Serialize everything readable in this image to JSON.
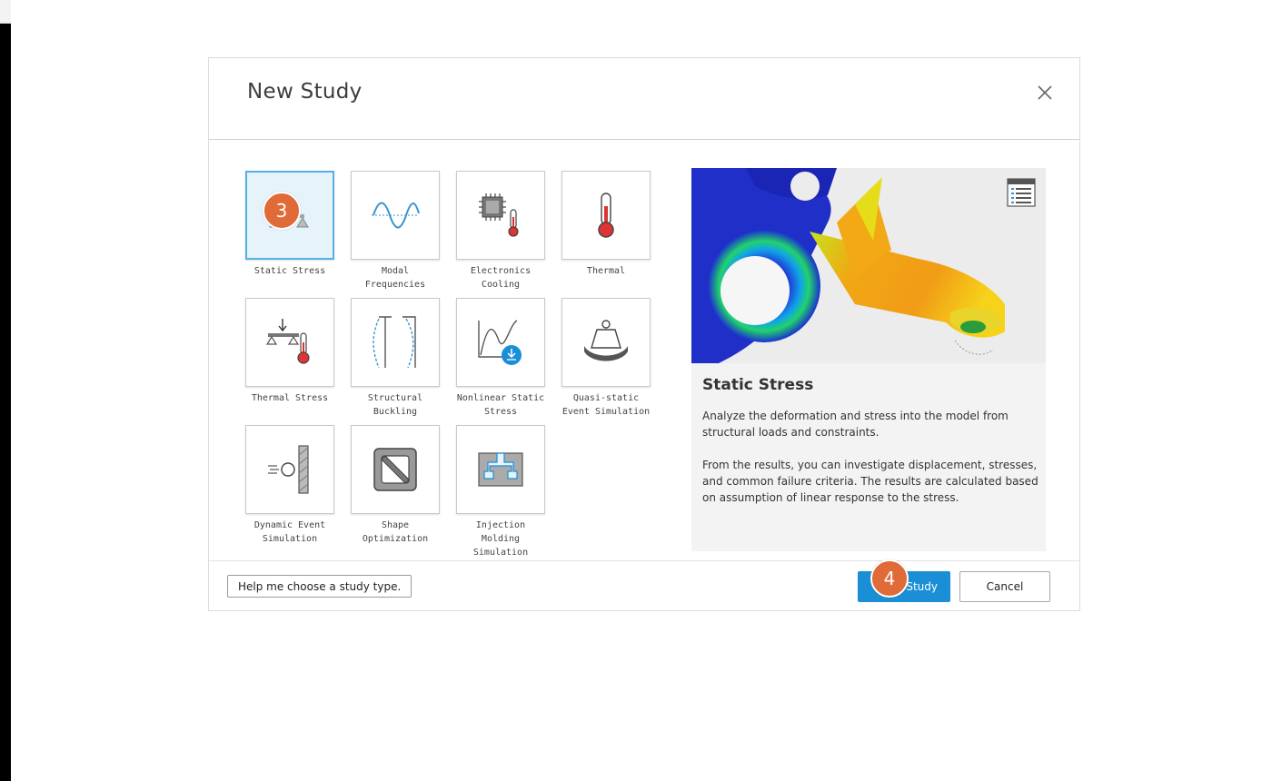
{
  "dialog": {
    "title": "New Study",
    "close_icon": "close-icon"
  },
  "study_types": [
    {
      "label": "Static Stress",
      "icon": "static-stress-icon",
      "selected": true
    },
    {
      "label": "Modal Frequencies",
      "icon": "sine-wave-icon",
      "selected": false
    },
    {
      "label": "Electronics Cooling",
      "icon": "chip-thermometer-icon",
      "selected": false
    },
    {
      "label": "Thermal",
      "icon": "thermometer-icon",
      "selected": false
    },
    {
      "label": "Thermal Stress",
      "icon": "thermal-stress-icon",
      "selected": false
    },
    {
      "label": "Structural Buckling",
      "icon": "buckling-icon",
      "selected": false
    },
    {
      "label": "Nonlinear Static Stress",
      "icon": "nonlinear-curve-icon",
      "selected": false
    },
    {
      "label": "Quasi-static Event Simulation",
      "icon": "weight-icon",
      "selected": false
    },
    {
      "label": "Dynamic Event Simulation",
      "icon": "impact-icon",
      "selected": false
    },
    {
      "label": "Shape Optimization",
      "icon": "shape-optimization-icon",
      "selected": false
    },
    {
      "label": "Injection Molding Simulation",
      "icon": "mold-icon",
      "selected": false
    }
  ],
  "preview": {
    "title": "Static Stress",
    "description_1": "Analyze the deformation and stress into the model from structural loads and constraints.",
    "description_2": "From the results, you can investigate displacement, stresses, and common failure criteria. The results are calculated based on assumption of linear response to the stress.",
    "list_icon": "list-view-icon"
  },
  "footer": {
    "help_label": "Help me choose a study type.",
    "create_label": "Study",
    "cancel_label": "Cancel"
  },
  "badges": {
    "step_3": "3",
    "step_4": "4",
    "color": "#e06a38"
  },
  "colors": {
    "accent": "#1a8fd6",
    "selected_border": "#56b0e2",
    "selected_bg": "#e6f3fb"
  }
}
